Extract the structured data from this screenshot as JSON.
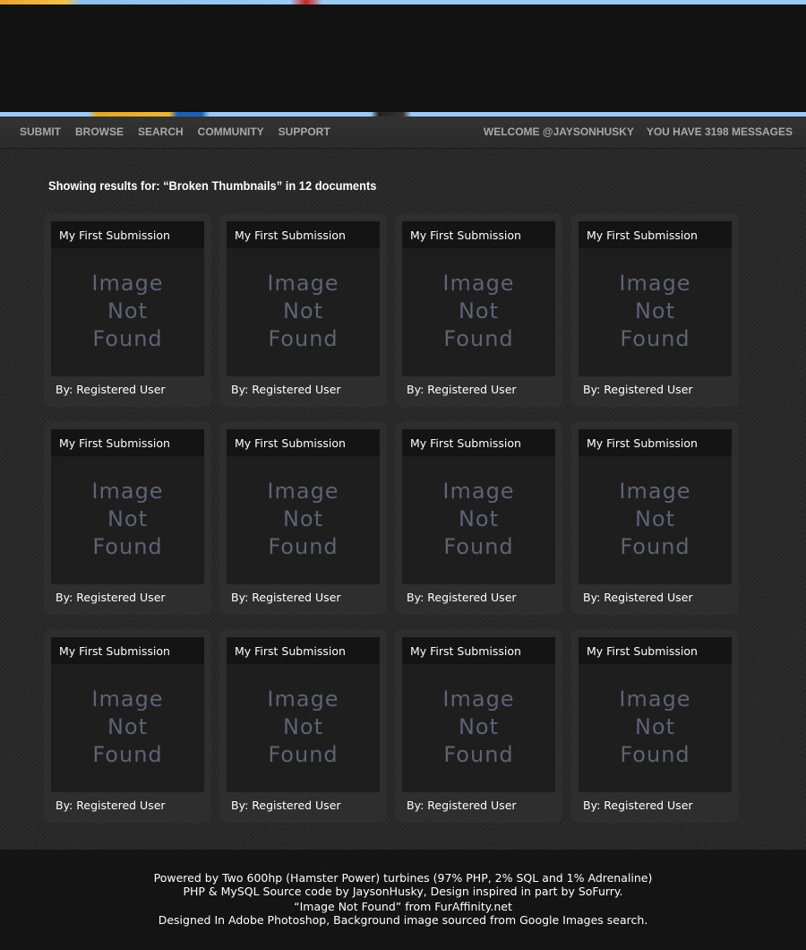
{
  "nav": {
    "items": [
      "SUBMIT",
      "BROWSE",
      "SEARCH",
      "COMMUNITY",
      "SUPPORT"
    ],
    "welcome": "WELCOME @JAYSONHUSKY",
    "messages": "YOU HAVE 3198 MESSAGES"
  },
  "results_heading": "Showing results for: “Broken Thumbnails” in 12 documents",
  "cards": [
    {
      "title": "My First Submission",
      "image": "Image Not Found",
      "by": "By: Registered User"
    },
    {
      "title": "My First Submission",
      "image": "Image Not Found",
      "by": "By: Registered User"
    },
    {
      "title": "My First Submission",
      "image": "Image Not Found",
      "by": "By: Registered User"
    },
    {
      "title": "My First Submission",
      "image": "Image Not Found",
      "by": "By: Registered User"
    },
    {
      "title": "My First Submission",
      "image": "Image Not Found",
      "by": "By: Registered User"
    },
    {
      "title": "My First Submission",
      "image": "Image Not Found",
      "by": "By: Registered User"
    },
    {
      "title": "My First Submission",
      "image": "Image Not Found",
      "by": "By: Registered User"
    },
    {
      "title": "My First Submission",
      "image": "Image Not Found",
      "by": "By: Registered User"
    },
    {
      "title": "My First Submission",
      "image": "Image Not Found",
      "by": "By: Registered User"
    },
    {
      "title": "My First Submission",
      "image": "Image Not Found",
      "by": "By: Registered User"
    },
    {
      "title": "My First Submission",
      "image": "Image Not Found",
      "by": "By: Registered User"
    },
    {
      "title": "My First Submission",
      "image": "Image Not Found",
      "by": "By: Registered User"
    }
  ],
  "footer": [
    "Powered by Two 600hp (Hamster Power) turbines (97% PHP, 2% SQL and 1% Adrenaline)",
    "PHP & MySQL Source code by JaysonHusky, Design inspired in part by SoFurry.",
    "“Image Not Found” from FurAffinity.net",
    "Designed In Adobe Photoshop, Background image sourced from Google Images search."
  ]
}
